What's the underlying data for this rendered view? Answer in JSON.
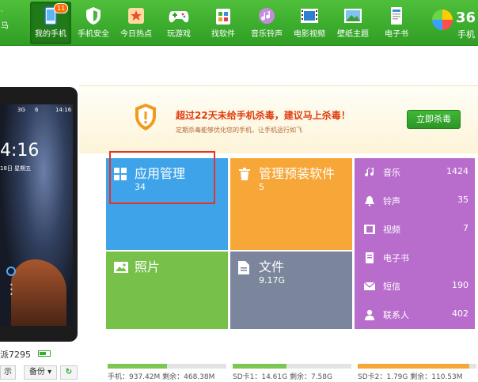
{
  "colors": {
    "topbar": "#3aa82d",
    "apps_tile": "#3fa3ea",
    "preinstalled_tile": "#f7a738",
    "photos_tile": "#77c04a",
    "files_tile": "#7b859b",
    "side_list": "#b86ccc",
    "alert_title": "#e03b0c",
    "highlight_box": "#e3342b"
  },
  "header": {
    "left_stub": [
      "‵",
      "马"
    ],
    "nav": [
      {
        "label": "我的手机",
        "icon": "phone-icon",
        "badge": "11"
      },
      {
        "label": "手机安全",
        "icon": "shield-icon"
      },
      {
        "label": "今日热点",
        "icon": "star-icon"
      },
      {
        "label": "玩游戏",
        "icon": "gamepad-icon"
      },
      {
        "label": "找软件",
        "icon": "apps-icon"
      },
      {
        "label": "音乐铃声",
        "icon": "music-icon"
      },
      {
        "label": "电影视频",
        "icon": "film-icon"
      },
      {
        "label": "壁纸主题",
        "icon": "image-icon"
      },
      {
        "label": "电子书",
        "icon": "book-icon"
      }
    ],
    "brand_line1": "36",
    "brand_line2": "手机"
  },
  "phone": {
    "status_signal1": "3G",
    "status_signal2": "6",
    "status_time": "14:16",
    "clock": "4:16",
    "date": "18日 星期五",
    "device_name": "派7295",
    "buttons": [
      "示",
      "备份 ▾",
      "↻"
    ]
  },
  "alert": {
    "title": "超过22天未给手机杀毒，建议马上杀毒！",
    "subtitle": "定期杀毒能够优化您的手机，让手机运行如飞",
    "button": "立即杀毒"
  },
  "tiles": {
    "apps": {
      "name": "应用管理",
      "value": "34"
    },
    "preinstalled": {
      "name": "管理预装软件",
      "value": "5"
    },
    "photos": {
      "name": "照片"
    },
    "files": {
      "name": "文件",
      "value": "9.17G"
    }
  },
  "side_list": [
    {
      "name": "音乐",
      "value": "1424",
      "icon": "music-note-icon"
    },
    {
      "name": "铃声",
      "value": "35",
      "icon": "bell-icon"
    },
    {
      "name": "视频",
      "value": "7",
      "icon": "video-icon"
    },
    {
      "name": "电子书",
      "value": "",
      "icon": "ebook-icon"
    },
    {
      "name": "短信",
      "value": "190",
      "icon": "mail-icon"
    },
    {
      "name": "联系人",
      "value": "402",
      "icon": "contact-icon"
    }
  ],
  "storage": [
    {
      "text": "手机：937.42M   剩余：468.38M",
      "used_fraction": 0.5,
      "color": "#7cc654"
    },
    {
      "text": "SD卡1：14.61G   剩余：7.58G",
      "used_fraction": 0.45,
      "color": "#7cc654"
    },
    {
      "text": "SD卡2：1.79G   剩余：110.53M",
      "used_fraction": 0.94,
      "color": "#f7a738"
    }
  ]
}
